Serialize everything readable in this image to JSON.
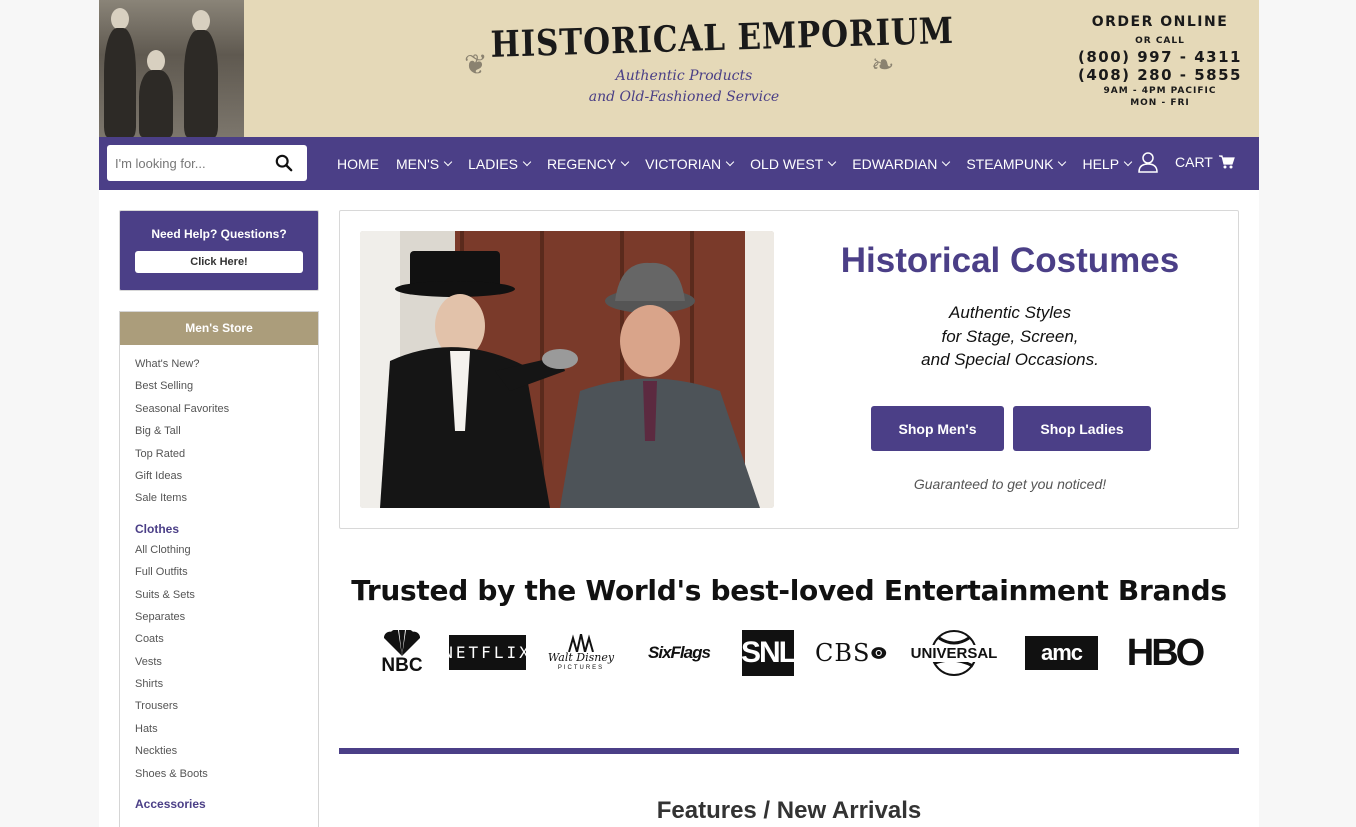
{
  "header": {
    "logo_title": "HISTORICAL EMPORIUM",
    "logo_sub1": "Authentic Products",
    "logo_sub2": "and Old-Fashioned Service",
    "contact": {
      "order_online": "ORDER ONLINE",
      "or_call": "OR CALL",
      "phone1": "(800) 997 - 4311",
      "phone2": "(408) 280 - 5855",
      "hours1": "9AM - 4PM PACIFIC",
      "hours2": "MON - FRI"
    }
  },
  "nav": {
    "search_placeholder": "I'm looking for...",
    "items": [
      {
        "label": "HOME",
        "dropdown": false
      },
      {
        "label": "MEN'S",
        "dropdown": true
      },
      {
        "label": "LADIES",
        "dropdown": true
      },
      {
        "label": "REGENCY",
        "dropdown": true
      },
      {
        "label": "VICTORIAN",
        "dropdown": true
      },
      {
        "label": "OLD WEST",
        "dropdown": true
      },
      {
        "label": "EDWARDIAN",
        "dropdown": true
      },
      {
        "label": "STEAMPUNK",
        "dropdown": true
      },
      {
        "label": "HELP",
        "dropdown": true
      }
    ],
    "cart_label": "CART"
  },
  "sidebar": {
    "help_title": "Need Help? Questions?",
    "help_button": "Click Here!",
    "store_title": "Men's Store",
    "top_links": [
      "What's New?",
      "Best Selling",
      "Seasonal Favorites",
      "Big & Tall",
      "Top Rated",
      "Gift Ideas",
      "Sale Items"
    ],
    "clothes_title": "Clothes",
    "clothes_links": [
      "All Clothing",
      "Full Outfits",
      "Suits & Sets",
      "Separates",
      "Coats",
      "Vests",
      "Shirts",
      "Trousers",
      "Hats",
      "Neckties",
      "Shoes & Boots"
    ],
    "accessories_title": "Accessories"
  },
  "hero": {
    "title": "Historical Costumes",
    "tagline1": "Authentic Styles",
    "tagline2": "for Stage, Screen,",
    "tagline3": "and Special Occasions.",
    "btn_men": "Shop Men's",
    "btn_ladies": "Shop Ladies",
    "note": "Guaranteed to get you noticed!"
  },
  "trusted": {
    "title": "Trusted by the World's best-loved Entertainment Brands",
    "brands": [
      "NBC",
      "NETFLIX",
      "Walt Disney",
      "PICTURES",
      "SixFlags",
      "SNL",
      "CBS",
      "UNIVERSAL",
      "amc",
      "HBO"
    ]
  },
  "features_title": "Features / New Arrivals",
  "colors": {
    "brand_purple": "#4b3f87",
    "header_tan": "#e5d9b8",
    "store_head": "#ab9d7b"
  }
}
